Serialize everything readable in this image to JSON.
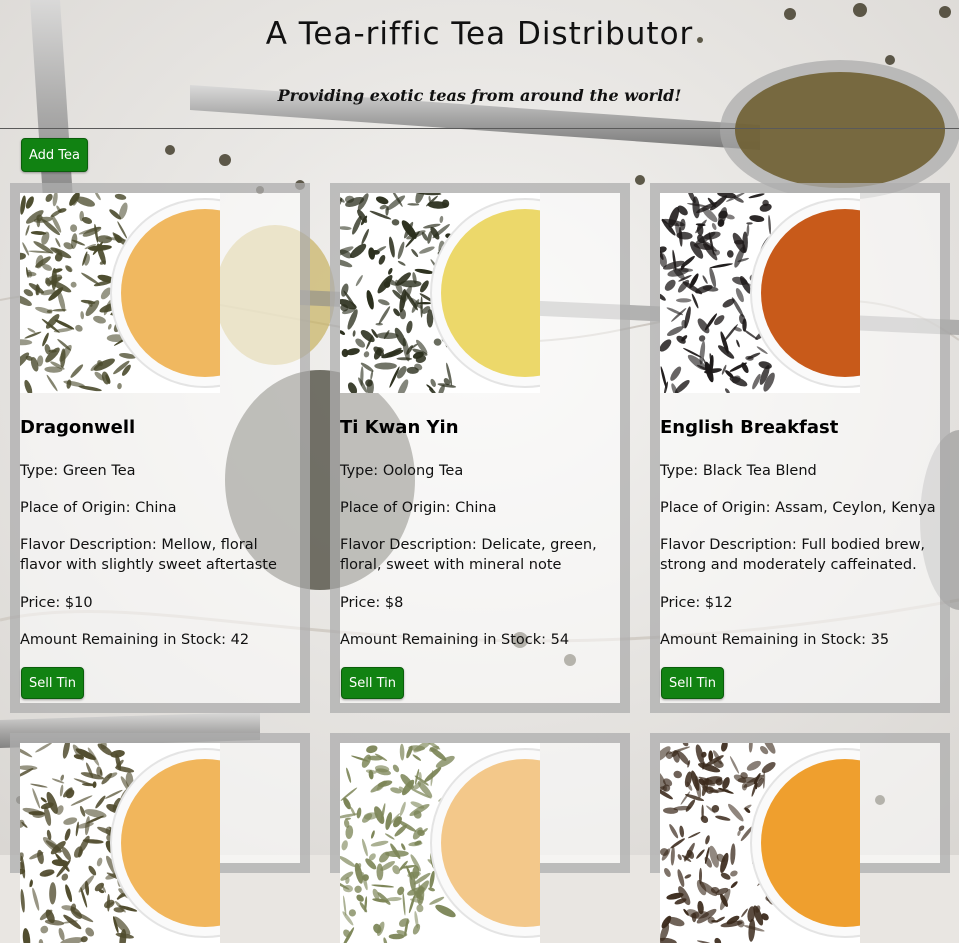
{
  "site": {
    "title": "A Tea-riffic Tea Distributor",
    "subtitle": "Providing exotic teas from around the world!"
  },
  "actions": {
    "add_tea_label": "Add Tea"
  },
  "labels": {
    "type": "Type: ",
    "origin": "Place of Origin: ",
    "flavor": "Flavor Description: ",
    "price": "Price: ",
    "stock": "Amount Remaining in Stock: ",
    "sell": "Sell Tin"
  },
  "teas": [
    {
      "name": "Dragonwell",
      "type": "Green Tea",
      "origin": "China",
      "flavor": "Mellow, floral flavor with slightly sweet aftertaste",
      "price": "$10",
      "stock": "42",
      "leaf_color": "#4a4a2c",
      "liquor_color": "#f0b860"
    },
    {
      "name": "Ti Kwan Yin",
      "type": "Oolong Tea",
      "origin": "China",
      "flavor": "Delicate, green, floral, sweet with mineral note",
      "price": "$8",
      "stock": "54",
      "leaf_color": "#2b2f1d",
      "liquor_color": "#ecd86a"
    },
    {
      "name": "English Breakfast",
      "type": "Black Tea Blend",
      "origin": "Assam, Ceylon, Kenya",
      "flavor": "Full bodied brew, strong and moderately caffeinated.",
      "price": "$12",
      "stock": "35",
      "leaf_color": "#1c1818",
      "liquor_color": "#c85a1a"
    }
  ],
  "partial_cards": [
    {
      "leaf_color": "#4f4a2c",
      "liquor_color": "#f1b65c"
    },
    {
      "leaf_color": "#7c8557",
      "liquor_color": "#f3c88a"
    },
    {
      "leaf_color": "#3b2a1c",
      "liquor_color": "#ef9f2e"
    }
  ]
}
